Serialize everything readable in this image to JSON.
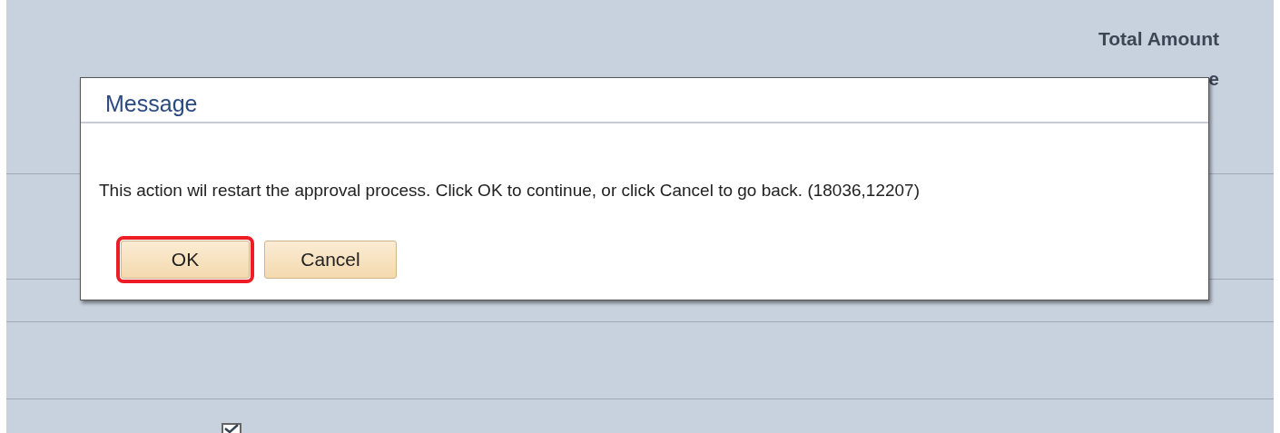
{
  "background": {
    "column_heading": "Total Amount",
    "column_heading_2": "e",
    "checkbox": {
      "checked": true
    }
  },
  "dialog": {
    "title": "Message",
    "message": "This action wil restart the approval process. Click OK to continue, or click Cancel to go back. (18036,12207)",
    "buttons": [
      {
        "label": "OK",
        "highlighted": true
      },
      {
        "label": "Cancel",
        "highlighted": false
      }
    ]
  }
}
